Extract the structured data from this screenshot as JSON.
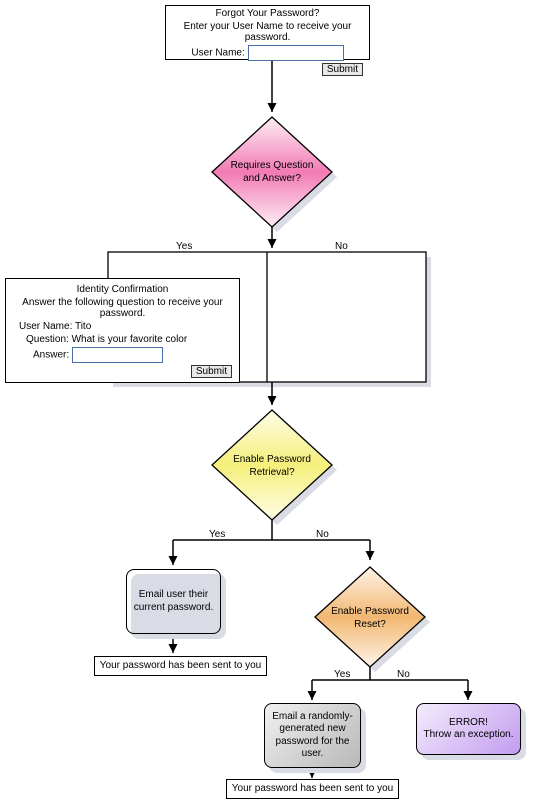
{
  "form1": {
    "title": "Forgot Your Password?",
    "instruction": "Enter your User Name to receive your password.",
    "userNameLabel": "User Name:",
    "userNameValue": "",
    "submit": "Submit"
  },
  "decision1": {
    "text": "Requires Question\nand Answer?"
  },
  "edges1": {
    "yes": "Yes",
    "no": "No"
  },
  "form2": {
    "title": "Identity Confirmation",
    "instruction": "Answer the following question to receive your password.",
    "userNameLabel": "User Name:",
    "userNameValue": "Tito",
    "questionLabel": "Question:",
    "questionValue": "What is your favorite color",
    "answerLabel": "Answer:",
    "answerValue": "",
    "submit": "Submit"
  },
  "decision2": {
    "text": "Enable Password\nRetrieval?"
  },
  "edges2": {
    "yes": "Yes",
    "no": "No"
  },
  "proc1": "Email user their\ncurrent password.",
  "msg1": "Your password has been sent to you",
  "decision3": {
    "text": "Enable Password\nReset?"
  },
  "edges3": {
    "yes": "Yes",
    "no": "No"
  },
  "proc2": "Email a randomly-\ngenerated new\npassword for the\nuser.",
  "msg2": "Your password has been sent to you",
  "proc3": "ERROR!\nThrow an exception."
}
